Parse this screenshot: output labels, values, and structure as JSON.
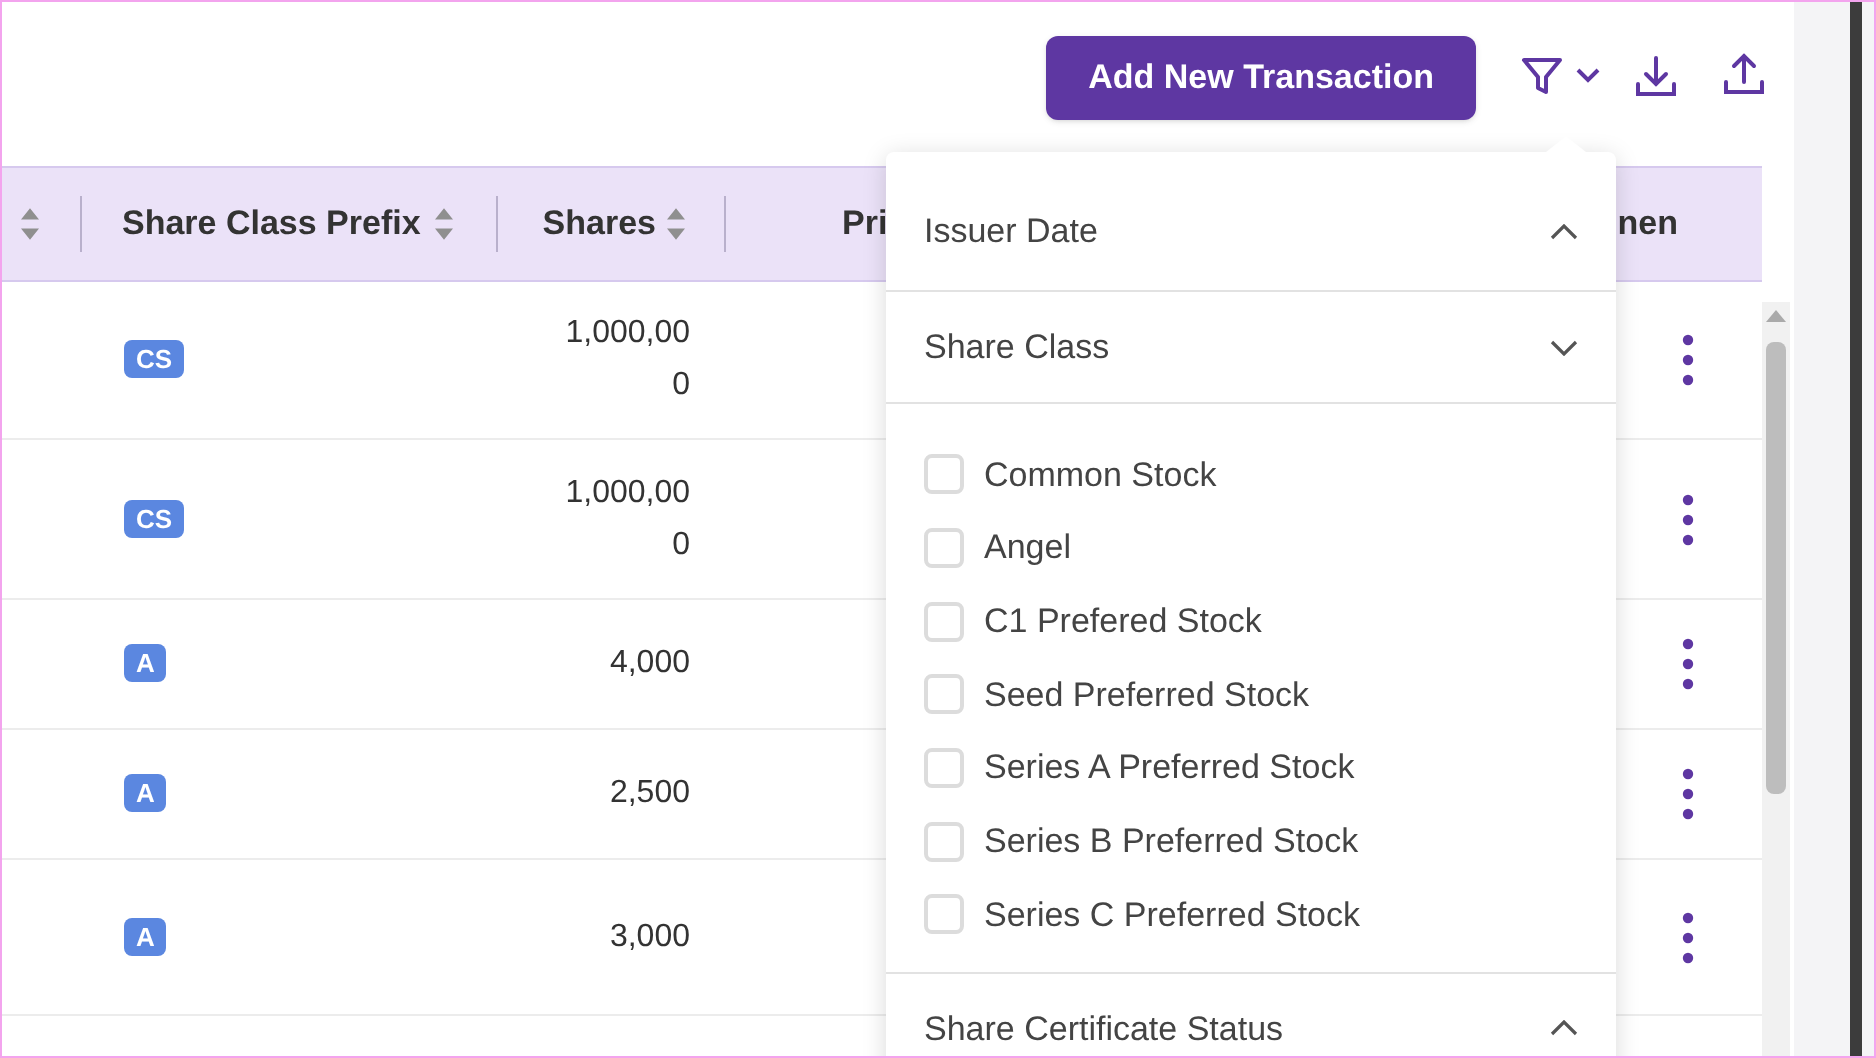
{
  "toolbar": {
    "add_button": "Add New Transaction"
  },
  "table": {
    "columns": [
      {
        "sortable": true
      },
      {
        "label": "Share Class Prefix",
        "sortable": true
      },
      {
        "label": "Shares",
        "sortable": true
      },
      {
        "label": "Pri",
        "sortable": false
      },
      {
        "label": "nen",
        "sortable": false
      }
    ],
    "rows": [
      {
        "prefix": "CS",
        "shares": "1,000,000"
      },
      {
        "prefix": "CS",
        "shares": "1,000,000"
      },
      {
        "prefix": "A",
        "shares": "4,000"
      },
      {
        "prefix": "A",
        "shares": "2,500"
      },
      {
        "prefix": "A",
        "shares": "3,000"
      }
    ]
  },
  "filter_panel": {
    "sections": [
      {
        "title": "Issuer Date",
        "expanded": false
      },
      {
        "title": "Share Class",
        "expanded": true,
        "options": [
          {
            "label": "Common Stock",
            "checked": false
          },
          {
            "label": "Angel",
            "checked": false
          },
          {
            "label": "C1 Prefered Stock",
            "checked": false
          },
          {
            "label": "Seed Preferred Stock",
            "checked": false
          },
          {
            "label": "Series A Preferred Stock",
            "checked": false
          },
          {
            "label": "Series B Preferred Stock",
            "checked": false
          },
          {
            "label": "Series C Preferred Stock",
            "checked": false
          }
        ]
      },
      {
        "title": "Share Certificate Status",
        "expanded": false
      }
    ]
  }
}
